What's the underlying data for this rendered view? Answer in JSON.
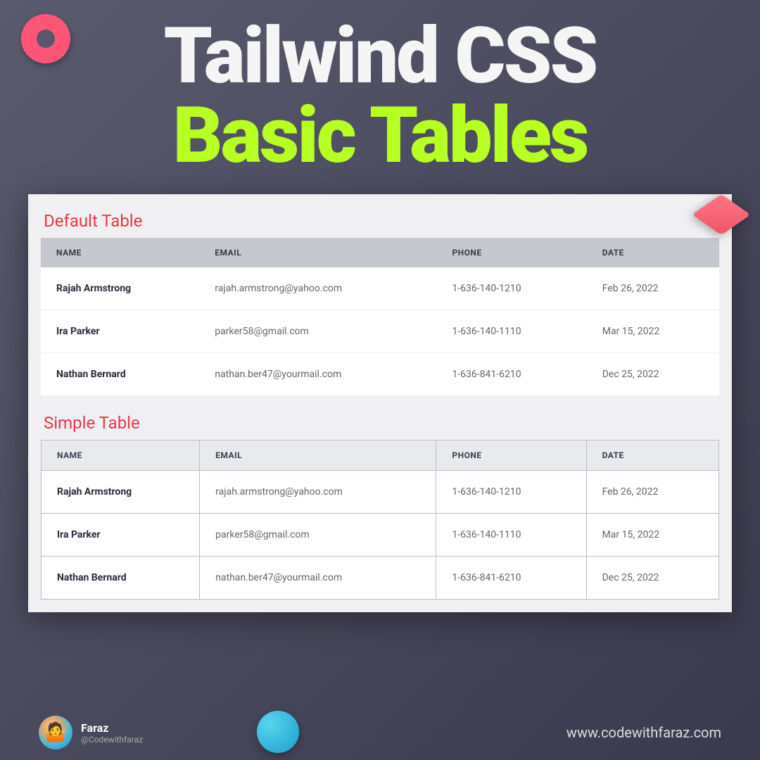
{
  "title": {
    "line1": "Tailwind CSS",
    "line2": "Basic Tables"
  },
  "sections": {
    "default": "Default Table",
    "simple": "Simple Table"
  },
  "headers": {
    "name": "NAME",
    "email": "EMAIL",
    "phone": "PHONE",
    "date": "DATE"
  },
  "rows": [
    {
      "name": "Rajah Armstrong",
      "email": "rajah.armstrong@yahoo.com",
      "phone": "1-636-140-1210",
      "date": "Feb 26, 2022"
    },
    {
      "name": "Ira Parker",
      "email": "parker58@gmail.com",
      "phone": "1-636-140-1110",
      "date": "Mar 15, 2022"
    },
    {
      "name": "Nathan Bernard",
      "email": "nathan.ber47@yourmail.com",
      "phone": "1-636-841-6210",
      "date": "Dec 25, 2022"
    }
  ],
  "author": {
    "name": "Faraz",
    "handle": "@Codewithfaraz",
    "avatar_emoji": "🤷"
  },
  "website": "www.codewithfaraz.com"
}
